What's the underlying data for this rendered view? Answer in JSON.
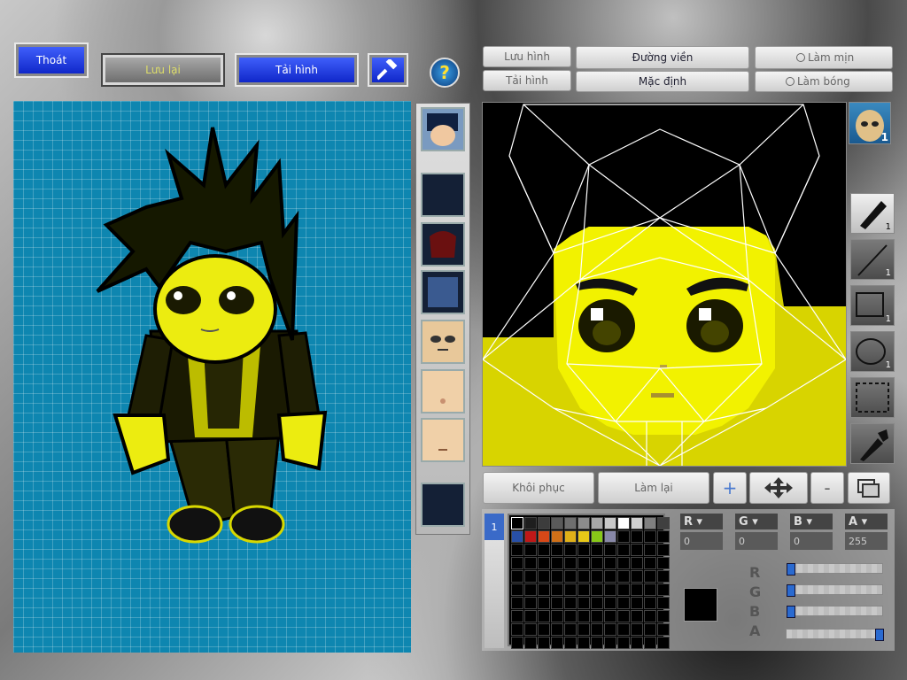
{
  "toolbar": {
    "exit_label": "Thoát",
    "save_label": "Lưu lại",
    "reload_label": "Tải hình"
  },
  "editor": {
    "save_image_label": "Lưu hình",
    "load_image_label": "Tải hình",
    "outline_label": "Đường viền",
    "default_label": "Mặc định",
    "smooth_label": "Làm mịn",
    "shade_label": "Làm bóng",
    "restore_label": "Khôi phục",
    "redo_label": "Làm lại",
    "zoom_in": "+",
    "zoom_out": "-",
    "face_badge": "1"
  },
  "tools": [
    {
      "name": "pen",
      "count": "1"
    },
    {
      "name": "line",
      "count": "1"
    },
    {
      "name": "rectangle",
      "count": "1"
    },
    {
      "name": "ellipse",
      "count": "1"
    },
    {
      "name": "selection",
      "count": ""
    },
    {
      "name": "eyedropper",
      "count": ""
    }
  ],
  "palette": {
    "tab_label": "1",
    "colors": [
      "#000000",
      "#1e1e1e",
      "#3c3c3c",
      "#5a5a5a",
      "#6e6e6e",
      "#8c8c8c",
      "#a8a8a8",
      "#c8c8c8",
      "#ffffff",
      "#d0d0d0",
      "#808080",
      "#404040",
      "#2850a8",
      "#c01818",
      "#d84818",
      "#d07018",
      "#e0b018",
      "#e8c818",
      "#88c818",
      "#8888a8"
    ]
  },
  "color_channels": {
    "r_label": "R",
    "g_label": "G",
    "b_label": "B",
    "a_label": "A",
    "r": "0",
    "g": "0",
    "b": "0",
    "a": "255",
    "slider_levels": {
      "r": 0,
      "g": 0,
      "b": 0,
      "a": 1
    }
  },
  "colors": {
    "accent_blue": "#1a3be0",
    "canvas_bg": "#0e86b0",
    "character_yellow": "#ecec10",
    "current_color": "#000000"
  }
}
